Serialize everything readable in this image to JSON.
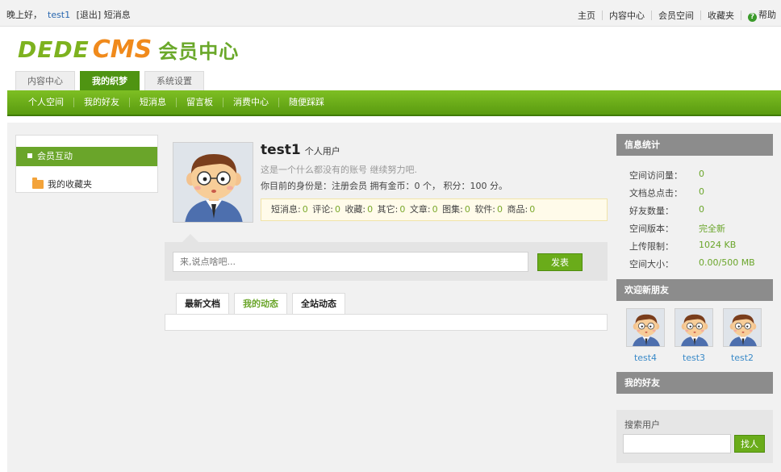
{
  "topbar": {
    "greeting": "晚上好，",
    "username": "test1",
    "logout": "[退出]",
    "messages": "短消息",
    "links": [
      "主页",
      "内容中心",
      "会员空间",
      "收藏夹"
    ],
    "help": "帮助"
  },
  "logo": {
    "part1": "DEDE",
    "part2": "CMS",
    "subtitle": "会员中心"
  },
  "main_tabs": [
    {
      "label": "内容中心",
      "active": false
    },
    {
      "label": "我的织梦",
      "active": true
    },
    {
      "label": "系统设置",
      "active": false
    }
  ],
  "green_nav": [
    "个人空间",
    "我的好友",
    "短消息",
    "留言板",
    "消费中心",
    "随便踩踩"
  ],
  "sidebar": {
    "section_title": "会员互动",
    "item": "我的收藏夹"
  },
  "profile": {
    "name": "test1",
    "type": "个人用户",
    "signature": "这是一个什么都没有的账号 继续努力吧.",
    "status_prefix": "你目前的身份是：注册会员 拥有金币：",
    "coins": "0",
    "coins_unit": "个，",
    "score_label": "积分：",
    "score": "100",
    "score_unit": "分。",
    "stats": [
      {
        "label": "短消息:",
        "value": "0"
      },
      {
        "label": "评论:",
        "value": "0"
      },
      {
        "label": "收藏:",
        "value": "0"
      },
      {
        "label": "其它:",
        "value": "0"
      },
      {
        "label": "文章:",
        "value": "0"
      },
      {
        "label": "图集:",
        "value": "0"
      },
      {
        "label": "软件:",
        "value": "0"
      },
      {
        "label": "商品:",
        "value": "0"
      }
    ]
  },
  "post": {
    "placeholder": "来,说点啥吧...",
    "button": "发表"
  },
  "feed_tabs": [
    {
      "label": "最新文档",
      "active": false
    },
    {
      "label": "我的动态",
      "active": true
    },
    {
      "label": "全站动态",
      "active": false
    }
  ],
  "info_stats": {
    "title": "信息统计",
    "rows": [
      {
        "label": "空间访问量：",
        "value": "0"
      },
      {
        "label": "文档总点击：",
        "value": "0"
      },
      {
        "label": "好友数量：",
        "value": "0"
      },
      {
        "label": "空间版本：",
        "value": "完全新"
      },
      {
        "label": "上传限制：",
        "value": "1024 KB"
      },
      {
        "label": "空间大小：",
        "value": "0.00/500 MB"
      }
    ]
  },
  "new_friends": {
    "title": "欢迎新朋友",
    "users": [
      "test4",
      "test3",
      "test2"
    ]
  },
  "my_friends": {
    "title": "我的好友"
  },
  "search_user": {
    "label": "搜索用户",
    "button": "找人"
  },
  "colors": {
    "green": "#6aa52a",
    "orange": "#f08a1c",
    "header_gray": "#8c8c8c"
  }
}
